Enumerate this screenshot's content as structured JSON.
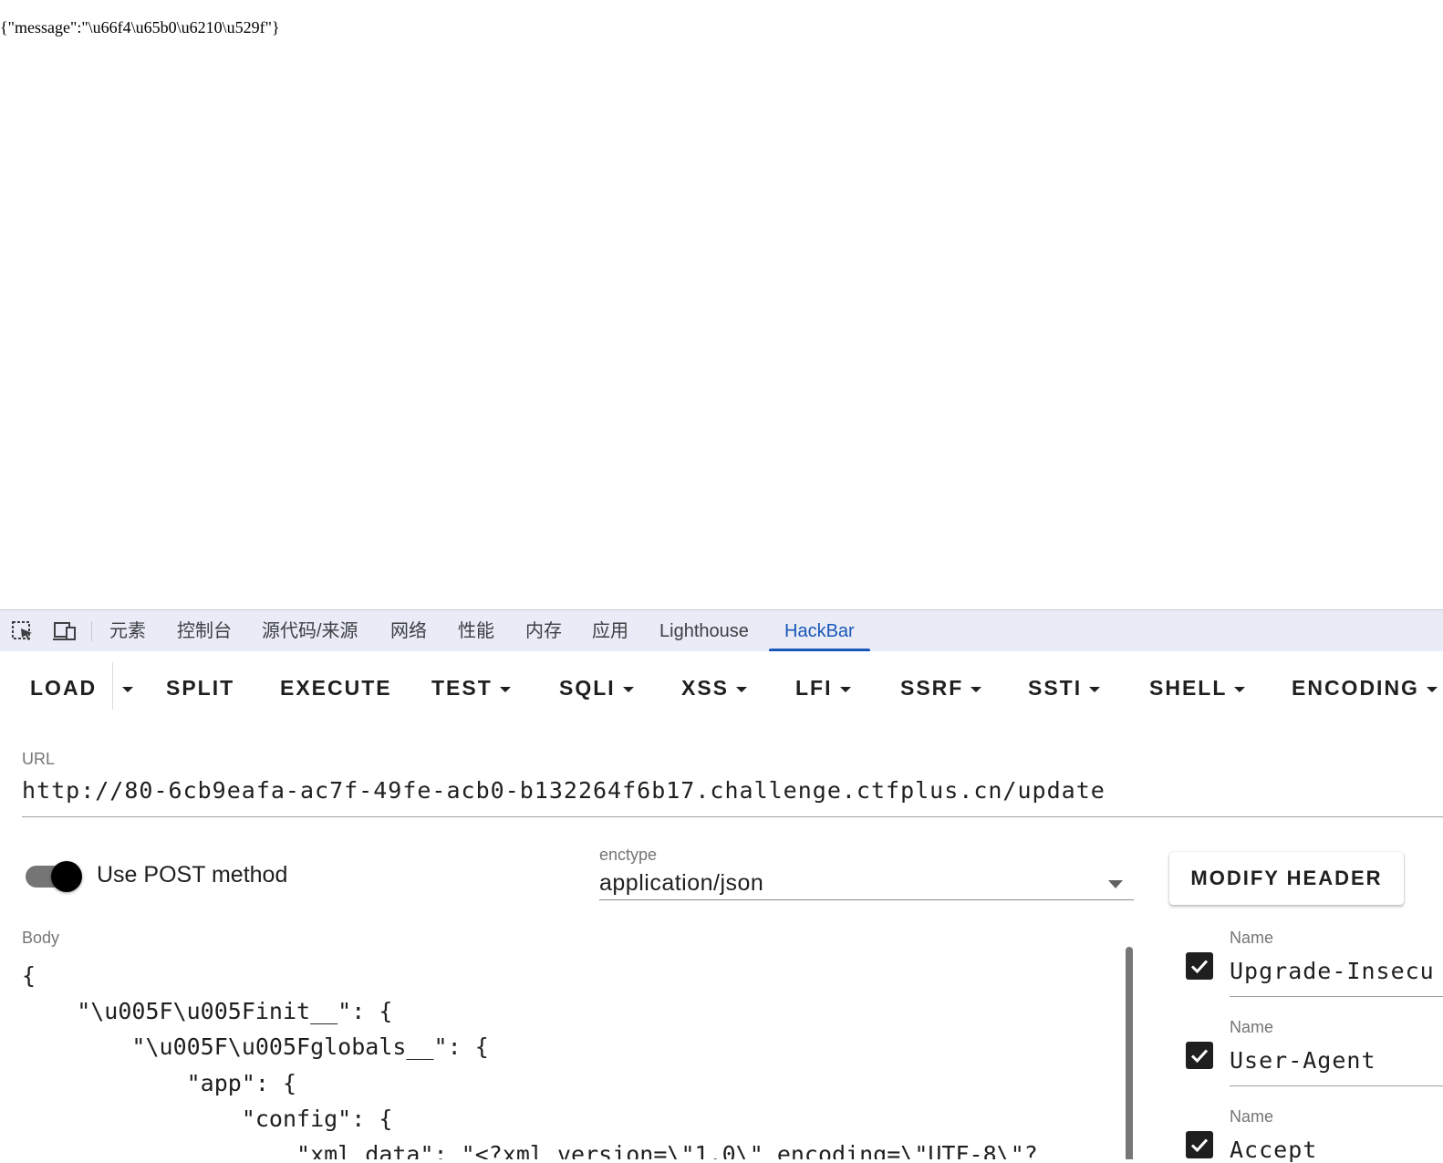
{
  "page": {
    "response_text": "{\"message\":\"\\u66f4\\u65b0\\u6210\\u529f\"}"
  },
  "devtools": {
    "icons": [
      "inspect-element-icon",
      "device-toolbar-icon"
    ],
    "tabs": [
      {
        "label": "元素"
      },
      {
        "label": "控制台"
      },
      {
        "label": "源代码/来源"
      },
      {
        "label": "网络"
      },
      {
        "label": "性能"
      },
      {
        "label": "内存"
      },
      {
        "label": "应用"
      },
      {
        "label": "Lighthouse"
      },
      {
        "label": "HackBar"
      }
    ],
    "active_tab": "HackBar",
    "accent_color": "#1a56b8"
  },
  "hackbar": {
    "toolbar": {
      "load": "LOAD",
      "split": "SPLIT",
      "execute": "EXECUTE",
      "test": "TEST",
      "sqli": "SQLI",
      "xss": "XSS",
      "lfi": "LFI",
      "ssrf": "SSRF",
      "ssti": "SSTI",
      "shell": "SHELL",
      "encoding": "ENCODING"
    },
    "url": {
      "label": "URL",
      "value": "http://80-6cb9eafa-ac7f-49fe-acb0-b132264f6b17.challenge.ctfplus.cn/update"
    },
    "post_toggle": {
      "label": "Use POST method",
      "enabled": true
    },
    "enctype": {
      "label": "enctype",
      "value": "application/json"
    },
    "modify_header_label": "MODIFY HEADER",
    "body": {
      "label": "Body",
      "lines": [
        "{",
        "    \"\\u005F\\u005Finit__\": {",
        "        \"\\u005F\\u005Fglobals__\": {",
        "            \"app\": {",
        "                \"config\": {",
        "                    \"xml_data\": \"<?xml version=\\\"1.0\\\" encoding=\\\"UTF-8\\\"?"
      ]
    },
    "headers": [
      {
        "name_label": "Name",
        "value": "Upgrade-Insecu",
        "checked": true
      },
      {
        "name_label": "Name",
        "value": "User-Agent",
        "checked": true
      },
      {
        "name_label": "Name",
        "value": "Accept",
        "checked": true
      }
    ]
  }
}
